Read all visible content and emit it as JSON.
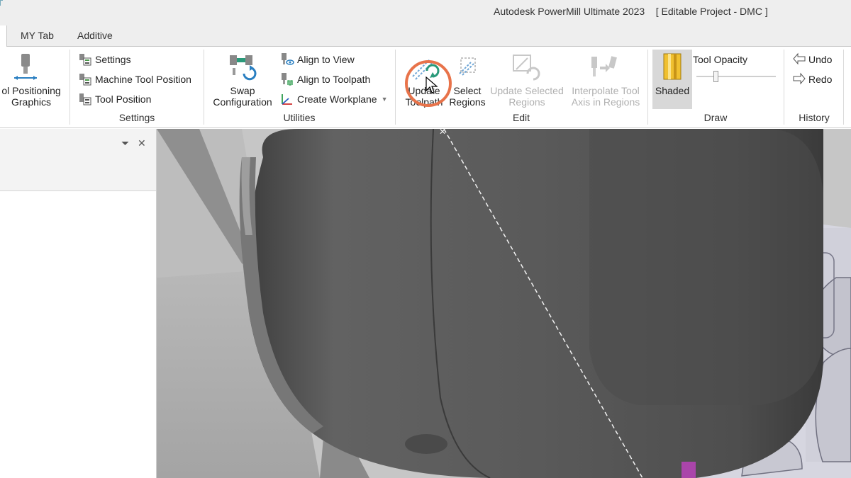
{
  "window": {
    "title": "Autodesk PowerMill Ultimate 2023    [ Editable Project - DMC ]"
  },
  "tabs": [
    {
      "label": "MY Tab"
    },
    {
      "label": "Additive"
    }
  ],
  "ribbon": {
    "tool_positioning": {
      "label_line1": "ol Positioning",
      "label_line2": "Graphics"
    },
    "settings_group": {
      "label": "Settings",
      "items": [
        "Settings",
        "Machine Tool Position",
        "Tool Position"
      ]
    },
    "utilities_group": {
      "label": "Utilities",
      "swap_line1": "Swap",
      "swap_line2": "Configuration",
      "items": [
        "Align to View",
        "Align to Toolpath",
        "Create Workplane"
      ]
    },
    "edit_group": {
      "label": "Edit",
      "update_toolpath_line1": "Update",
      "update_toolpath_line2": "Toolpath",
      "select_regions_line1": "Select",
      "select_regions_line2": "Regions",
      "update_selected_line1": "Update Selected",
      "update_selected_line2": "Regions",
      "interpolate_line1": "Interpolate Tool",
      "interpolate_line2": "Axis in Regions"
    },
    "draw_group": {
      "label": "Draw",
      "shaded_label": "Shaded",
      "opacity_label": "Tool Opacity"
    },
    "history_group": {
      "label": "History",
      "undo_label": "Undo",
      "redo_label": "Redo"
    }
  },
  "panel": {
    "dropdown_glyph": "⏷",
    "close_glyph": "✕"
  },
  "colors": {
    "accent_highlight": "#e8734a",
    "tool_body": "#5a5a5a",
    "shaded_icon": "#e0b21c"
  }
}
